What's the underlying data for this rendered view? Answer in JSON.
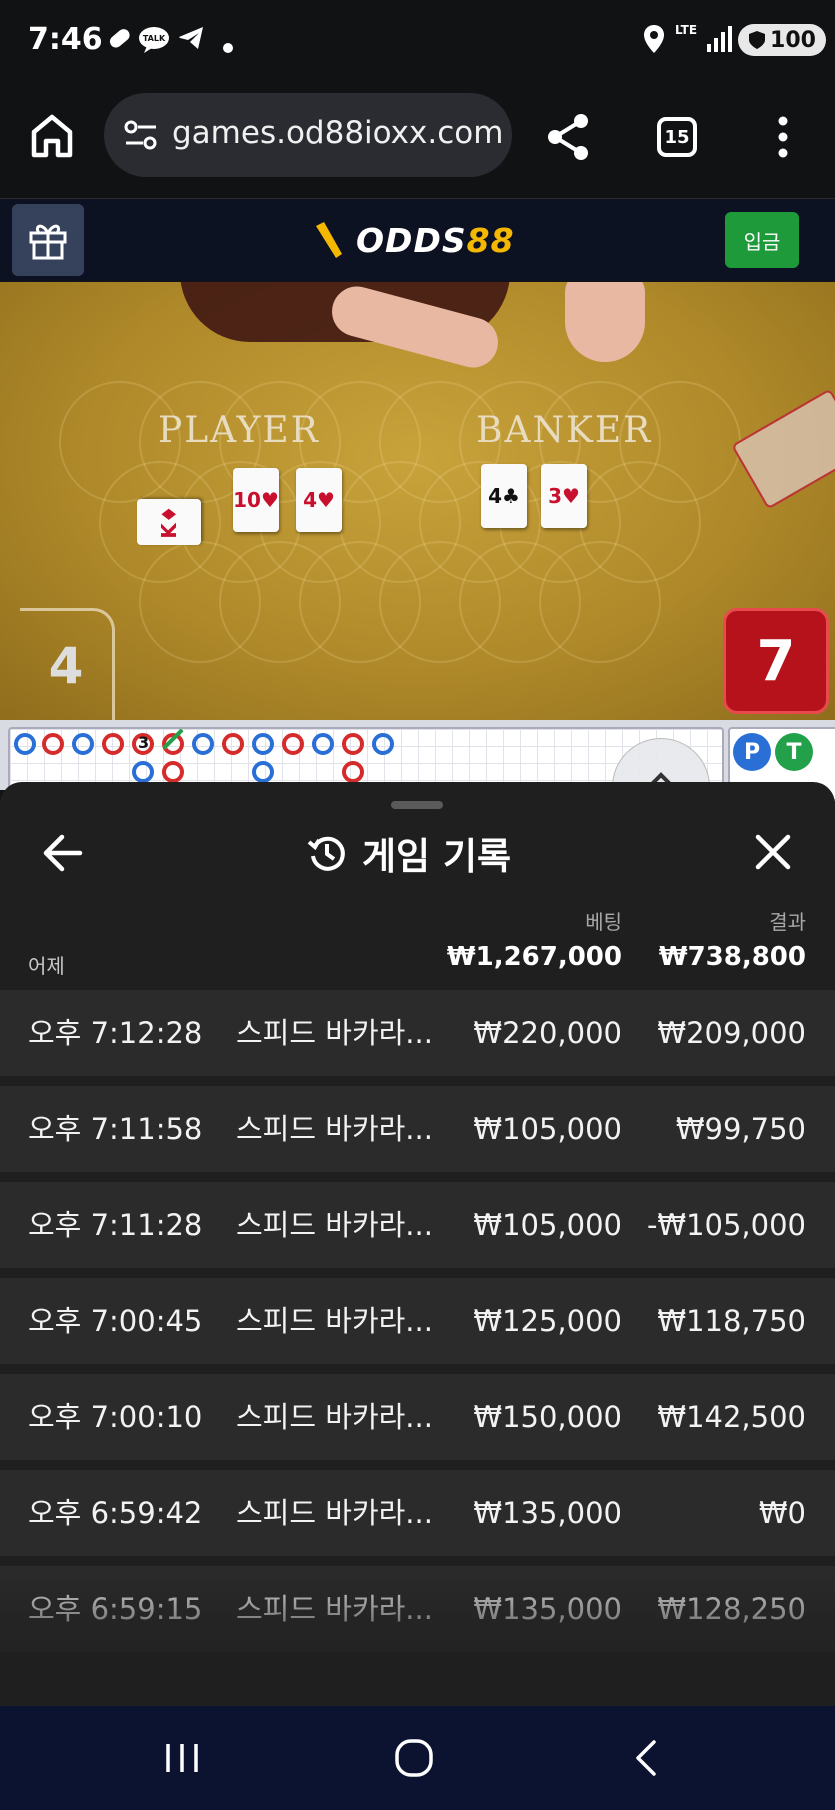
{
  "status_bar": {
    "time": "7:46",
    "talk_badge": "TALK",
    "network": "LTE",
    "battery": "100"
  },
  "browser": {
    "url": "games.od88ioxx.com",
    "tab_count": "15"
  },
  "site": {
    "logo_main": "ODDS",
    "logo_num": "88",
    "deposit_label": "입금",
    "brand_yellow": "#f5b800",
    "deposit_green": "#1e9a3a"
  },
  "game": {
    "player_label": "PLAYER",
    "banker_label": "BANKER",
    "player_cards": [
      {
        "rank": "K",
        "suit": "♦",
        "color": "red"
      },
      {
        "rank": "10",
        "suit": "♥",
        "color": "red"
      },
      {
        "rank": "4",
        "suit": "♥",
        "color": "red"
      }
    ],
    "banker_cards": [
      {
        "rank": "4",
        "suit": "♣",
        "color": "black"
      },
      {
        "rank": "3",
        "suit": "♥",
        "color": "red"
      }
    ],
    "player_score": "4",
    "banker_score": "7",
    "road_marker": "3",
    "road_buttons": [
      "P",
      "T"
    ]
  },
  "history": {
    "title": "게임 기록",
    "col_bet": "베팅",
    "col_result": "결과",
    "date_label": "어제",
    "total_bet": "₩1,267,000",
    "total_result": "₩738,800",
    "rows": [
      {
        "time": "오후 7:12:28",
        "game": "스피드 바카라...",
        "bet": "₩220,000",
        "result": "₩209,000"
      },
      {
        "time": "오후 7:11:58",
        "game": "스피드 바카라...",
        "bet": "₩105,000",
        "result": "₩99,750"
      },
      {
        "time": "오후 7:11:28",
        "game": "스피드 바카라...",
        "bet": "₩105,000",
        "result": "-₩105,000"
      },
      {
        "time": "오후 7:00:45",
        "game": "스피드 바카라...",
        "bet": "₩125,000",
        "result": "₩118,750"
      },
      {
        "time": "오후 7:00:10",
        "game": "스피드 바카라...",
        "bet": "₩150,000",
        "result": "₩142,500"
      },
      {
        "time": "오후 6:59:42",
        "game": "스피드 바카라...",
        "bet": "₩135,000",
        "result": "₩0"
      },
      {
        "time": "오후 6:59:15",
        "game": "스피드 바카라...",
        "bet": "₩135,000",
        "result": "₩128,250"
      }
    ]
  }
}
